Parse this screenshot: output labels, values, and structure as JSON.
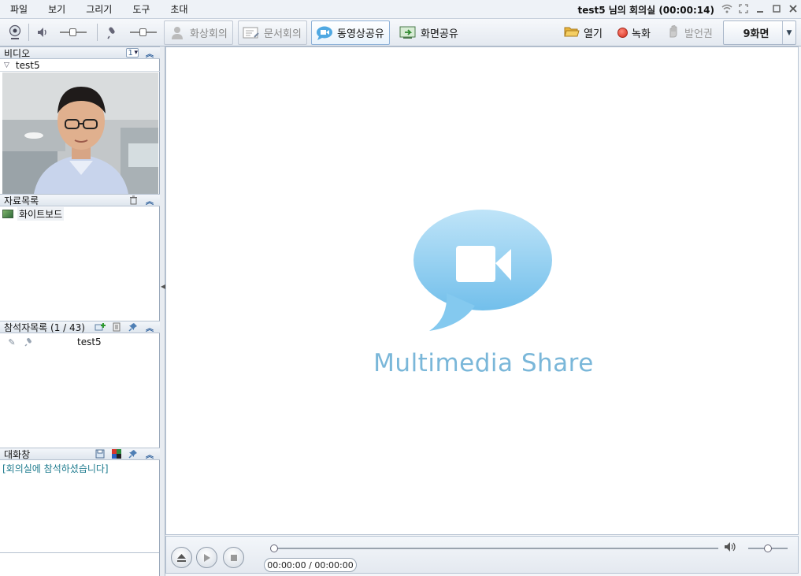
{
  "menu": [
    "파일",
    "보기",
    "그리기",
    "도구",
    "초대"
  ],
  "room_title": "test5 님의 회의실 (00:00:14)",
  "toolbar": {
    "modes": [
      {
        "label": "화상회의",
        "active": false
      },
      {
        "label": "문서회의",
        "active": false
      },
      {
        "label": "동영상공유",
        "active": true
      },
      {
        "label": "화면공유",
        "active": false
      }
    ],
    "open_label": "열기",
    "record_label": "녹화",
    "speak_label": "발언권",
    "screen_count": "9화면"
  },
  "video": {
    "header": "비디오",
    "layout_value": "1",
    "user": "test5"
  },
  "documents": {
    "header": "자료목록",
    "items": [
      "화이트보드"
    ]
  },
  "participants": {
    "header": "참석자목록 (1 / 43)",
    "items": [
      {
        "name": "test5"
      }
    ]
  },
  "chat": {
    "header": "대화창",
    "messages": [
      "[회의실에 참석하셨습니다]"
    ]
  },
  "main": {
    "logo_text": "Multimedia Share"
  },
  "player": {
    "time": "00:00:00 / 00:00:00",
    "progress": 0,
    "volume": 0.5
  },
  "colors": {
    "logo_bubble": "#7cc6ee",
    "logo_text": "#7ab7d9",
    "chat_text": "#1e7b8e",
    "record": "#d42a1a"
  }
}
